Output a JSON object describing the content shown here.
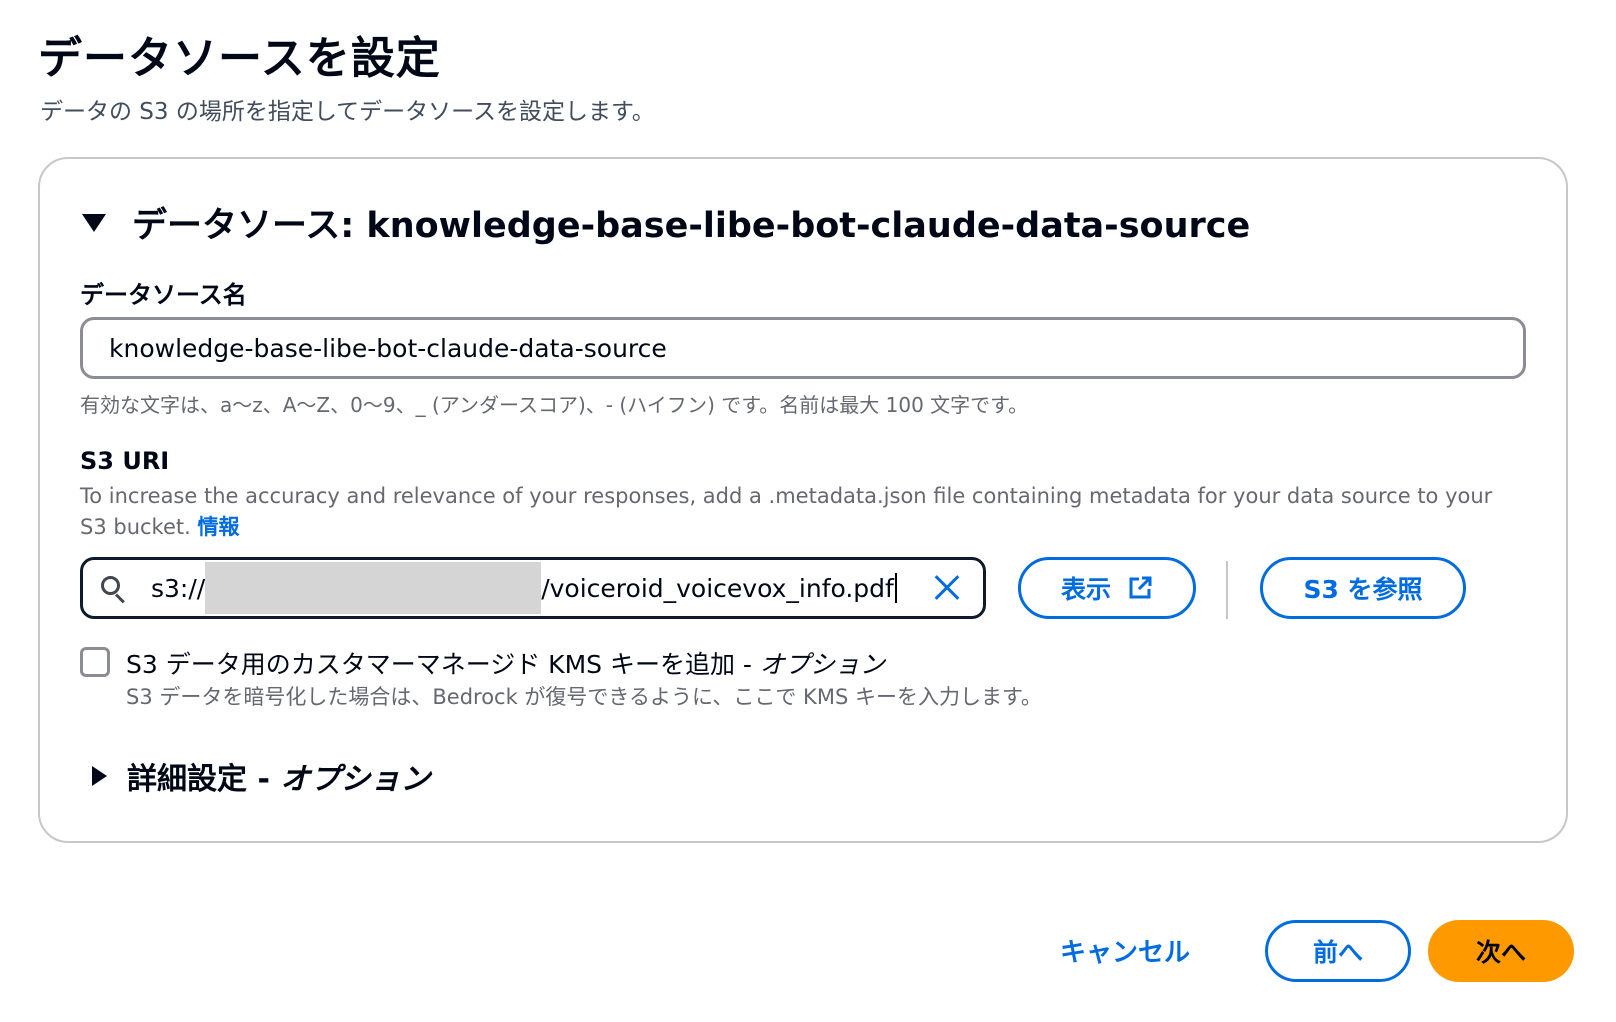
{
  "page": {
    "title": "データソースを設定",
    "subtitle": "データの S3 の場所を指定してデータソースを設定します。"
  },
  "data_source": {
    "section_title": "データソース: knowledge-base-libe-bot-claude-data-source",
    "name_label": "データソース名",
    "name_value": "knowledge-base-libe-bot-claude-data-source",
    "name_hint": "有効な文字は、a〜z、A〜Z、0〜9、_ (アンダースコア)、- (ハイフン) です。名前は最大 100 文字です。",
    "s3_label": "S3 URI",
    "s3_description": "To increase the accuracy and relevance of your responses, add a .metadata.json file containing metadata for your data source to your S3 bucket.",
    "info_link": "情報",
    "s3_uri_prefix": "s3://",
    "s3_uri_suffix": "/voiceroid_voicevox_info.pdf",
    "view_button": "表示",
    "browse_button": "S3 を参照",
    "kms_checkbox_label": "S3 データ用のカスタマーマネージド KMS キーを追加 - ",
    "kms_checkbox_optional": "オプション",
    "kms_checkbox_checked": false,
    "kms_description": "S3 データを暗号化した場合は、Bedrock が復号できるように、ここで KMS キーを入力します。",
    "advanced_title": "詳細設定 - ",
    "advanced_optional": "オプション"
  },
  "footer": {
    "cancel": "キャンセル",
    "prev": "前へ",
    "next": "次へ"
  },
  "icons": {
    "section_toggle": "caret-down-icon",
    "advanced_toggle": "caret-right-icon",
    "search": "search-icon",
    "clear": "close-icon",
    "external": "external-link-icon"
  },
  "colors": {
    "link": "#006ce0",
    "primary_button": "#ff9900",
    "text": "#000716",
    "secondary_text": "#656871"
  }
}
